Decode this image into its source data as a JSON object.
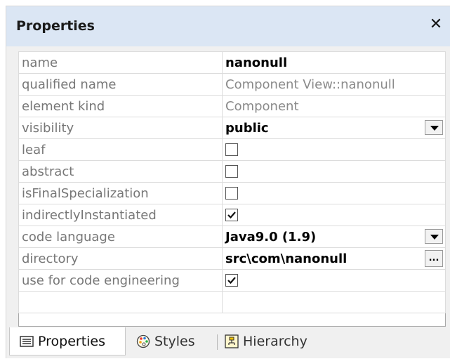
{
  "panel": {
    "title": "Properties",
    "close_glyph": "✕"
  },
  "rows": [
    {
      "key": "name",
      "value": "nanonull",
      "kind": "text"
    },
    {
      "key": "qualified name",
      "value": "Component View::nanonull",
      "kind": "readonly"
    },
    {
      "key": "element kind",
      "value": "Component",
      "kind": "readonly"
    },
    {
      "key": "visibility",
      "value": "public",
      "kind": "dropdown"
    },
    {
      "key": "leaf",
      "value": "",
      "kind": "checkbox",
      "checked": false
    },
    {
      "key": "abstract",
      "value": "",
      "kind": "checkbox",
      "checked": false
    },
    {
      "key": "isFinalSpecialization",
      "value": "",
      "kind": "checkbox",
      "checked": false
    },
    {
      "key": "indirectlyInstantiated",
      "value": "",
      "kind": "checkbox",
      "checked": true
    },
    {
      "key": "code language",
      "value": "Java9.0 (1.9)",
      "kind": "dropdown"
    },
    {
      "key": "directory",
      "value": "src\\com\\nanonull",
      "kind": "browse",
      "button": "..."
    },
    {
      "key": "use for code engineering",
      "value": "",
      "kind": "checkbox",
      "checked": true
    }
  ],
  "tabs": [
    {
      "label": "Properties",
      "icon": "properties-icon",
      "active": true
    },
    {
      "label": "Styles",
      "icon": "palette-icon",
      "active": false
    },
    {
      "label": "Hierarchy",
      "icon": "hierarchy-icon",
      "active": false
    }
  ],
  "colors": {
    "title_bar": "#dbe6f4",
    "panel_bg": "#f0f0f0",
    "key_text": "#777777",
    "readonly_text": "#8a8a8a"
  }
}
